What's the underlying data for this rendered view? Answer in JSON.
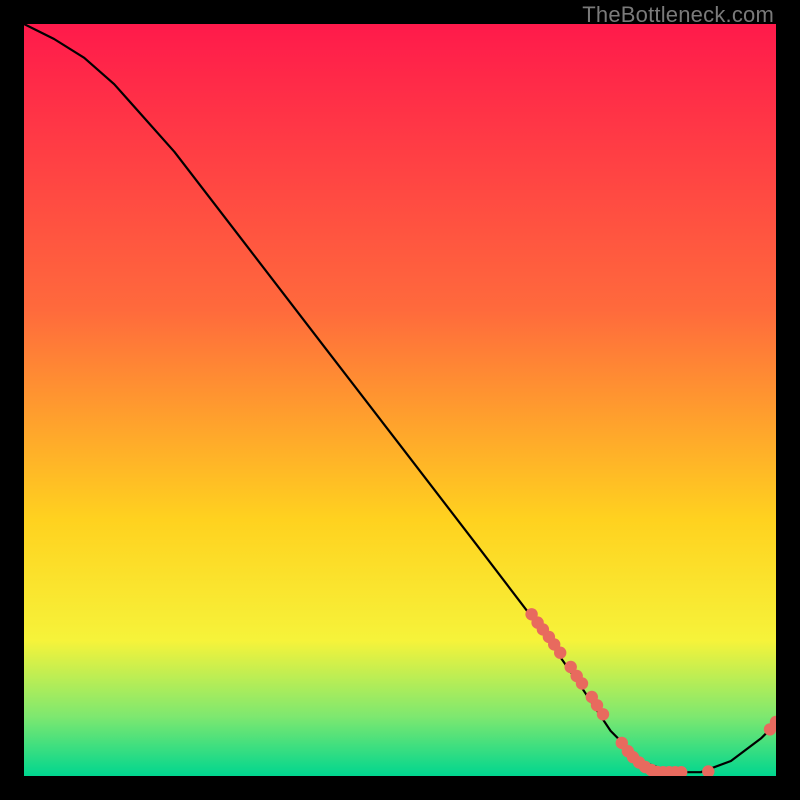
{
  "watermark": "TheBottleneck.com",
  "colors": {
    "curve": "#000000",
    "marker": "#e86a5e",
    "gradient_top": "#ff1a4b",
    "gradient_mid1": "#ff6a3c",
    "gradient_mid2": "#ffd21f",
    "gradient_mid3": "#f6f33a",
    "gradient_band": "#7fe86f",
    "gradient_bottom": "#00d68f"
  },
  "chart_data": {
    "type": "line",
    "title": "",
    "xlabel": "",
    "ylabel": "",
    "xlim": [
      0,
      100
    ],
    "ylim": [
      0,
      100
    ],
    "curve": [
      {
        "x": 0,
        "y": 100
      },
      {
        "x": 4,
        "y": 98
      },
      {
        "x": 8,
        "y": 95.5
      },
      {
        "x": 12,
        "y": 92
      },
      {
        "x": 20,
        "y": 83
      },
      {
        "x": 30,
        "y": 70
      },
      {
        "x": 40,
        "y": 57
      },
      {
        "x": 50,
        "y": 44
      },
      {
        "x": 60,
        "y": 31
      },
      {
        "x": 68,
        "y": 20.5
      },
      {
        "x": 74,
        "y": 12
      },
      {
        "x": 78,
        "y": 6
      },
      {
        "x": 82,
        "y": 2
      },
      {
        "x": 86,
        "y": 0.5
      },
      {
        "x": 90,
        "y": 0.5
      },
      {
        "x": 94,
        "y": 2
      },
      {
        "x": 98,
        "y": 5
      },
      {
        "x": 100,
        "y": 7
      }
    ],
    "markers": [
      {
        "x": 67.5,
        "y": 21.5
      },
      {
        "x": 68.3,
        "y": 20.4
      },
      {
        "x": 69.0,
        "y": 19.5
      },
      {
        "x": 69.8,
        "y": 18.5
      },
      {
        "x": 70.5,
        "y": 17.5
      },
      {
        "x": 71.3,
        "y": 16.4
      },
      {
        "x": 72.7,
        "y": 14.5
      },
      {
        "x": 73.5,
        "y": 13.3
      },
      {
        "x": 74.2,
        "y": 12.3
      },
      {
        "x": 75.5,
        "y": 10.5
      },
      {
        "x": 76.2,
        "y": 9.4
      },
      {
        "x": 77.0,
        "y": 8.2
      },
      {
        "x": 79.5,
        "y": 4.4
      },
      {
        "x": 80.3,
        "y": 3.3
      },
      {
        "x": 81.0,
        "y": 2.5
      },
      {
        "x": 81.8,
        "y": 1.8
      },
      {
        "x": 82.6,
        "y": 1.2
      },
      {
        "x": 83.4,
        "y": 0.8
      },
      {
        "x": 84.2,
        "y": 0.55
      },
      {
        "x": 85.0,
        "y": 0.5
      },
      {
        "x": 85.8,
        "y": 0.5
      },
      {
        "x": 86.6,
        "y": 0.5
      },
      {
        "x": 87.4,
        "y": 0.5
      },
      {
        "x": 91.0,
        "y": 0.6
      },
      {
        "x": 99.2,
        "y": 6.2
      },
      {
        "x": 100.0,
        "y": 7.2
      }
    ]
  }
}
